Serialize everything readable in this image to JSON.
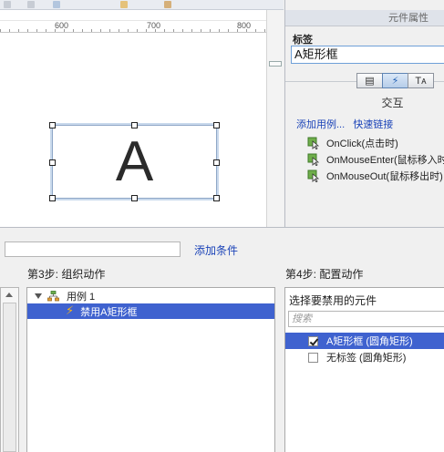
{
  "toolbar": {
    "icons": [
      "grid-icon",
      "align-icon",
      "color-icon",
      "style-icon",
      "arrange-icon"
    ]
  },
  "ruler": {
    "labels": [
      "600",
      "700",
      "800"
    ]
  },
  "canvas": {
    "widget_text": "A"
  },
  "properties": {
    "panel_title": "元件属性",
    "label_caption": "标签",
    "label_value": "A矩形框",
    "tabs": [
      "notes-tab",
      "interactions-tab",
      "style-tab"
    ],
    "tab_glyphs": [
      "▤",
      "⚡",
      "Tᴀ"
    ],
    "interaction_title": "交互",
    "add_case_link": "添加用例...",
    "quick_link": "快速链接",
    "events": [
      "OnClick(点击时)",
      "OnMouseEnter(鼠标移入时",
      "OnMouseOut(鼠标移出时)"
    ]
  },
  "dialog": {
    "add_condition": "添加条件",
    "step3_title": "第3步: 组织动作",
    "step4_title": "第4步: 配置动作",
    "case_name": "用例 1",
    "action_name": "禁用A矩形框",
    "config_title": "选择要禁用的元件",
    "search_placeholder": "搜索",
    "widgets": [
      {
        "label": "A矩形框 (圆角矩形)",
        "checked": true
      },
      {
        "label": "无标签 (圆角矩形)",
        "checked": false
      }
    ]
  },
  "colors": {
    "selection": "#3f62cf",
    "link": "#1c44b8",
    "bolt": "#f2b21b"
  }
}
